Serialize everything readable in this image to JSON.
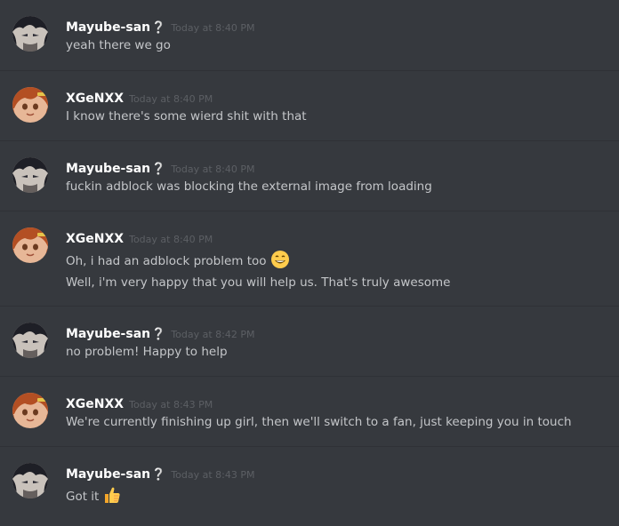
{
  "colors": {
    "background": "#36393e",
    "divider": "#2f3136",
    "username": "#ffffff",
    "timestamp": "#5c5f64",
    "message_text": "#c4c6c9"
  },
  "messages": [
    {
      "author": "Mayube-san",
      "badge": "❔",
      "avatar": "dark-hair-avatar",
      "timestamp": "Today at 8:40 PM",
      "lines": [
        "yeah there we go"
      ]
    },
    {
      "author": "XGeNXX",
      "avatar": "orange-hair-anime-avatar",
      "timestamp": "Today at 8:40 PM",
      "lines": [
        "I know there's some wierd shit with that"
      ]
    },
    {
      "author": "Mayube-san",
      "badge": "❔",
      "avatar": "dark-hair-avatar",
      "timestamp": "Today at 8:40 PM",
      "lines": [
        "fuckin adblock was blocking the external image from loading"
      ]
    },
    {
      "author": "XGeNXX",
      "avatar": "orange-hair-anime-avatar",
      "timestamp": "Today at 8:40 PM",
      "lines": [
        "Oh, i had an adblock problem too",
        "Well, i'm very happy that you will help us. That's truly awesome"
      ],
      "line_emoji": [
        "grinning-face-emoji",
        null
      ]
    },
    {
      "author": "Mayube-san",
      "badge": "❔",
      "avatar": "dark-hair-avatar",
      "timestamp": "Today at 8:42 PM",
      "lines": [
        "no problem! Happy to help"
      ]
    },
    {
      "author": "XGeNXX",
      "avatar": "orange-hair-anime-avatar",
      "timestamp": "Today at 8:43 PM",
      "lines": [
        "We're currently finishing up girl, then we'll switch to a fan, just keeping you in touch"
      ]
    },
    {
      "author": "Mayube-san",
      "badge": "❔",
      "avatar": "dark-hair-avatar",
      "timestamp": "Today at 8:43 PM",
      "lines": [
        "Got it"
      ],
      "line_emoji": [
        "thumbs-up-emoji"
      ]
    }
  ]
}
